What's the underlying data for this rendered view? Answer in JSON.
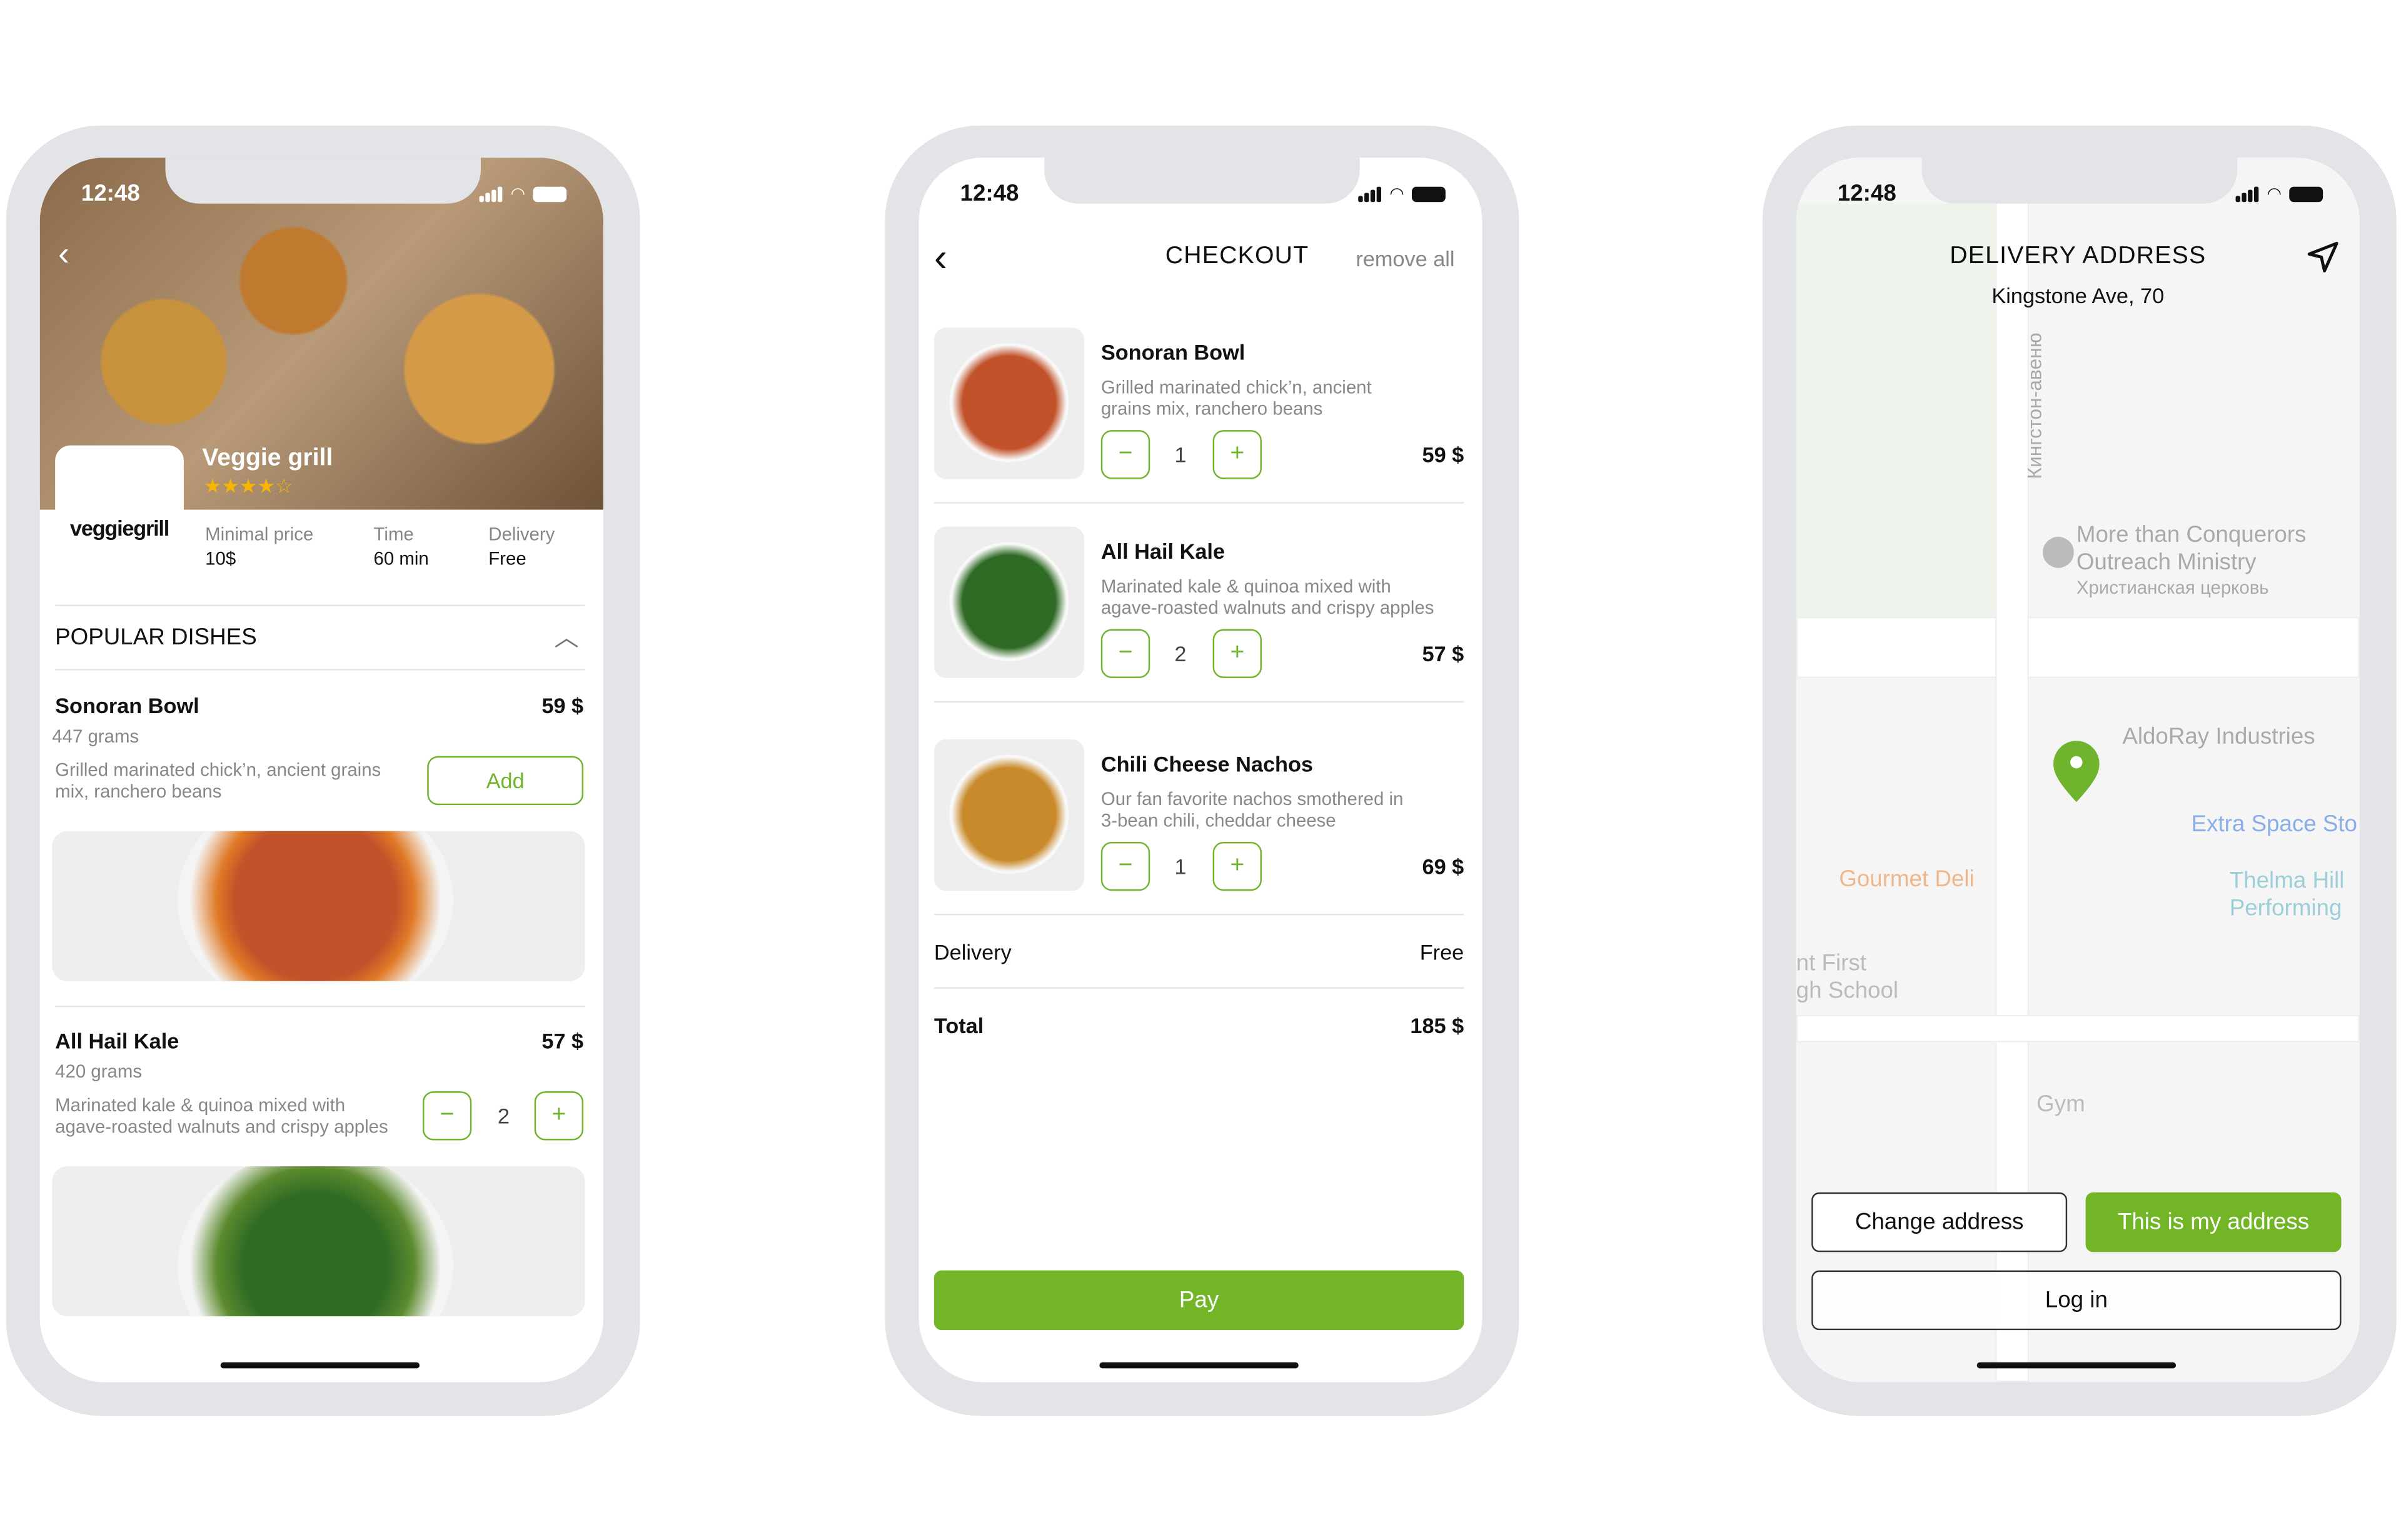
{
  "status": {
    "time": "12:48"
  },
  "restaurant": {
    "name": "Veggie grill",
    "logo_text": "veggiegrill",
    "rating": 4,
    "rating_max": 5,
    "stats": [
      {
        "label": "Minimal price",
        "value": "10$"
      },
      {
        "label": "Time",
        "value": "60 min"
      },
      {
        "label": "Delivery",
        "value": "Free"
      }
    ],
    "section_title": "POPULAR DISHES",
    "dishes": [
      {
        "name": "Sonoran Bowl",
        "price": "59 $",
        "weight": "447 grams",
        "desc1": "Grilled marinated chick’n, ancient grains",
        "desc2": "mix, ranchero beans",
        "action": "Add"
      },
      {
        "name": "All Hail Kale",
        "price": "57 $",
        "weight": "420 grams",
        "desc1": "Marinated kale & quinoa mixed with",
        "desc2": "agave-roasted walnuts and crispy apples",
        "qty": "2",
        "minus": "−",
        "plus": "+"
      }
    ]
  },
  "checkout": {
    "title": "CHECKOUT",
    "remove_all": "remove all",
    "items": [
      {
        "name": "Sonoran Bowl",
        "desc1": "Grilled marinated chick’n, ancient",
        "desc2": "grains mix, ranchero beans",
        "qty": "1",
        "price": "59 $"
      },
      {
        "name": "All Hail Kale",
        "desc1": "Marinated kale & quinoa mixed with",
        "desc2": "agave-roasted walnuts and crispy apples",
        "qty": "2",
        "price": "57 $"
      },
      {
        "name": "Chili Cheese Nachos",
        "desc1": "Our fan favorite nachos smothered in",
        "desc2": "3-bean chili, cheddar cheese",
        "qty": "1",
        "price": "69 $"
      }
    ],
    "minus": "−",
    "plus": "+",
    "delivery_label": "Delivery",
    "delivery_value": "Free",
    "total_label": "Total",
    "total_value": "185 $",
    "pay": "Pay"
  },
  "address": {
    "title": "DELIVERY ADDRESS",
    "address": "Kingstone Ave, 70",
    "map_labels": [
      "More than Conquerors",
      "Outreach Ministry",
      "Христианская церковь",
      "AldoRay Industries",
      "Extra Space Sto",
      "Thelma Hill",
      "Performing",
      "Gourmet Deli",
      "nt First",
      "gh School",
      "Gym",
      "Кингстон-авеню"
    ],
    "change_address": "Change address",
    "confirm": "This is my address",
    "login": "Log in"
  },
  "colors": {
    "accent": "#6fb42c",
    "star": "#f7b500",
    "frame": "#e3e4e8"
  }
}
